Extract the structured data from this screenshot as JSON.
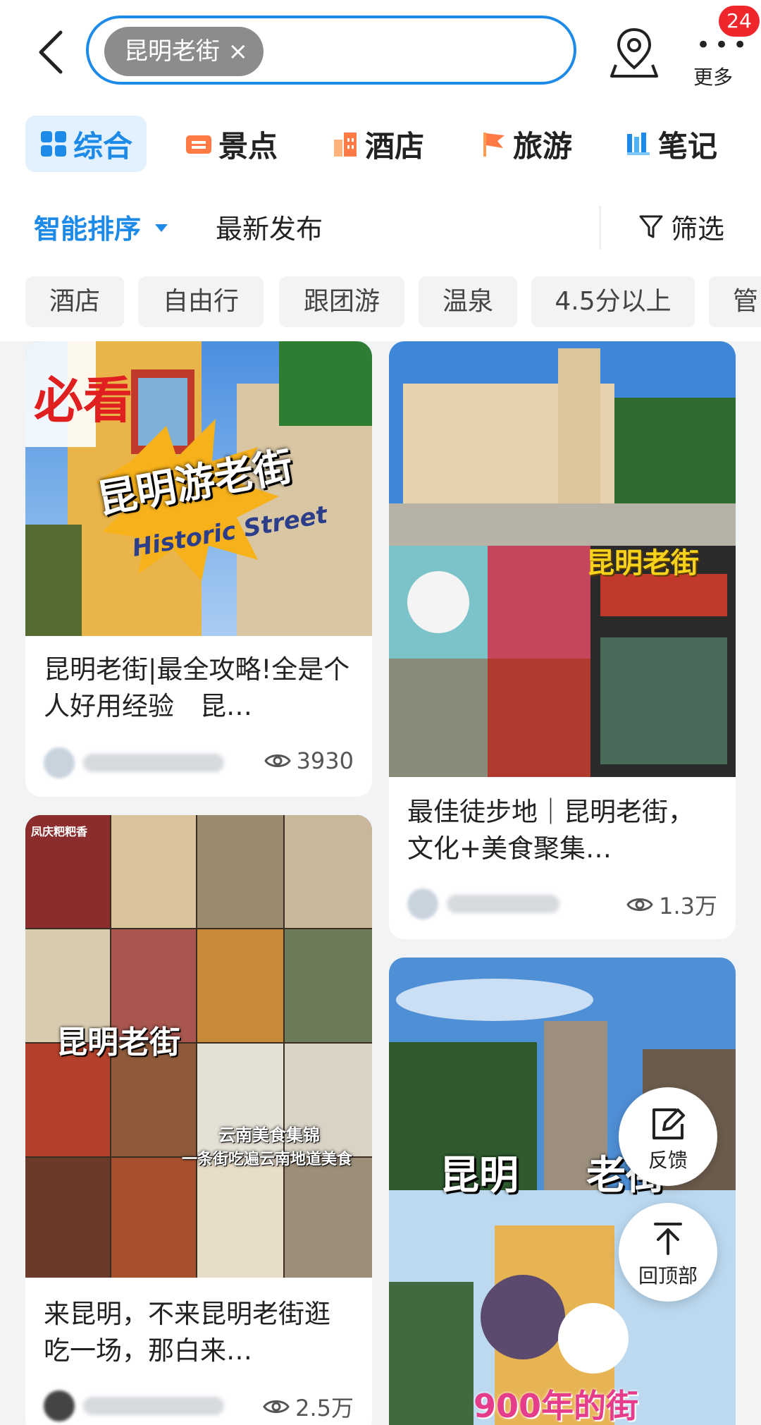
{
  "search": {
    "chip_text": "昆明老街",
    "chip_close": "×"
  },
  "header": {
    "more_label": "更多",
    "more_dots": "•••",
    "badge_count": "24"
  },
  "tabs": [
    {
      "label": "综合",
      "active": true
    },
    {
      "label": "景点"
    },
    {
      "label": "酒店"
    },
    {
      "label": "旅游"
    },
    {
      "label": "笔记"
    }
  ],
  "sort": {
    "smart": "智能排序",
    "latest": "最新发布",
    "filter": "筛选"
  },
  "tags": [
    "酒店",
    "自由行",
    "跟团游",
    "温泉",
    "4.5分以上",
    "管"
  ],
  "cards": [
    {
      "title": "昆明老街|最全攻略!全是个人好用经验　昆…",
      "views": "3930",
      "img_text_big": "昆明游老街",
      "img_text_side": "必看",
      "img_text_script": "Historic Street"
    },
    {
      "title": "最佳徒步地｜昆明老街，文化+美食聚集…",
      "views": "1.3万",
      "img_text_big": "昆明老街"
    },
    {
      "title": "来昆明，不来昆明老街逛吃一场，那白来…",
      "views": "2.5万",
      "img_text_big": "昆明老街",
      "img_text_sub1": "云南美食集锦",
      "img_text_sub2": "一条街吃遍云南地道美食",
      "img_text_top": "凤庆粑粑香"
    },
    {
      "img_text_big1": "昆明",
      "img_text_big2": "老街",
      "img_text_big3": "900年的街"
    }
  ],
  "floating": {
    "feedback": "反馈",
    "back_to_top": "回顶部"
  },
  "colors": {
    "accent": "#1e8ae8",
    "badge": "#f0262d",
    "feed_bg": "#f2f3f5"
  }
}
